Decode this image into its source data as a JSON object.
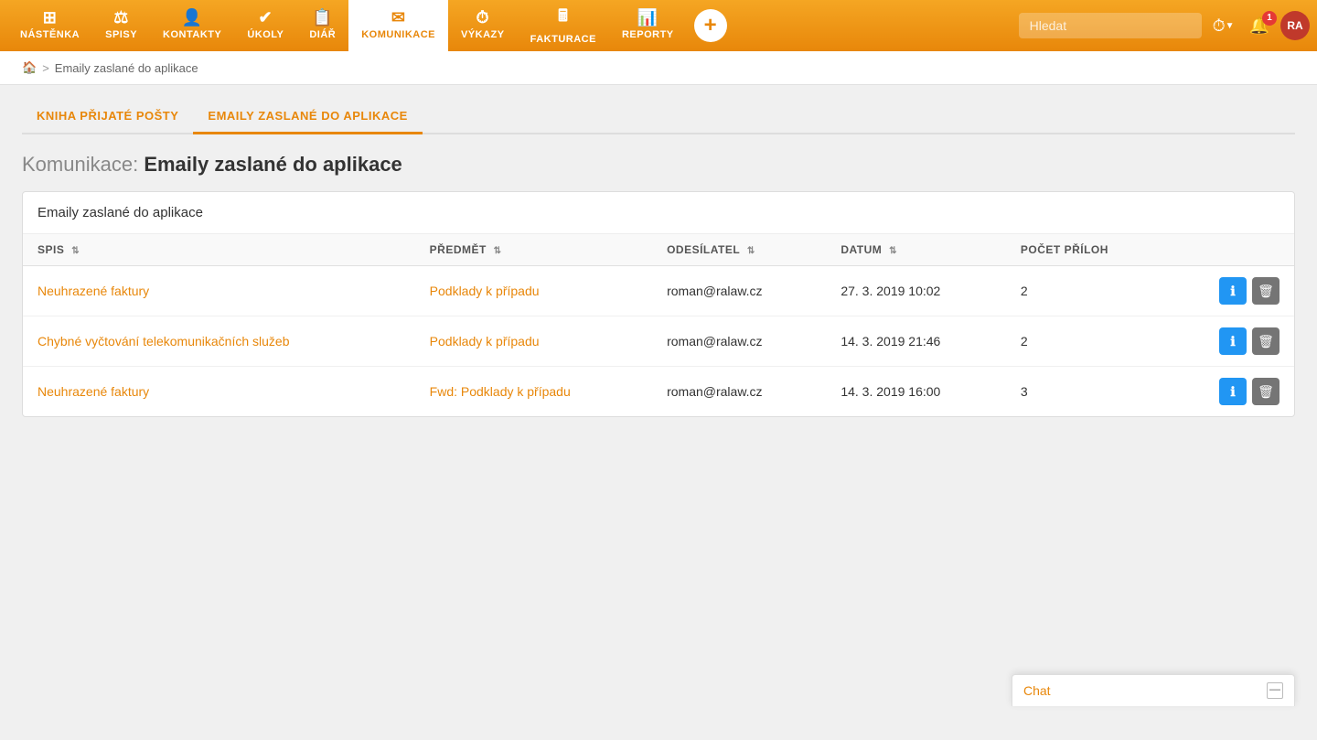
{
  "nav": {
    "items": [
      {
        "id": "nastenkа",
        "label": "NÁSTĚNKA",
        "icon": "⊞",
        "active": false
      },
      {
        "id": "spisy",
        "label": "SPISY",
        "icon": "⚖",
        "active": false
      },
      {
        "id": "kontakty",
        "label": "KONTAKTY",
        "icon": "👤",
        "active": false
      },
      {
        "id": "ukoly",
        "label": "ÚKOLY",
        "icon": "✔",
        "active": false
      },
      {
        "id": "diar",
        "label": "DIÁŘ",
        "icon": "📋",
        "active": false
      },
      {
        "id": "komunikace",
        "label": "KOMUNIKACE",
        "icon": "✉",
        "active": true
      },
      {
        "id": "vykazy",
        "label": "VÝKAZY",
        "icon": "⏱",
        "active": false
      },
      {
        "id": "fakturace",
        "label": "FAKTURACE",
        "icon": "🖩",
        "active": false
      },
      {
        "id": "reporty",
        "label": "REPORTY",
        "icon": "📊",
        "active": false
      }
    ],
    "add_button": "+",
    "search_placeholder": "Hledat",
    "notification_count": "1",
    "avatar_initials": "RA"
  },
  "breadcrumb": {
    "home_icon": "🏠",
    "separator": ">",
    "current": "Emaily zaslané do aplikace"
  },
  "tabs": [
    {
      "id": "kniha",
      "label": "KNIHA PŘIJATÉ POŠTY",
      "active": false
    },
    {
      "id": "emaily",
      "label": "EMAILY ZASLANÉ DO APLIKACE",
      "active": true
    }
  ],
  "page": {
    "title_label": "Komunikace:",
    "title_main": "Emaily zaslané do aplikace"
  },
  "table": {
    "card_title": "Emaily zaslané do aplikace",
    "columns": [
      {
        "id": "spis",
        "label": "SPIS",
        "sortable": true
      },
      {
        "id": "predmet",
        "label": "PŘEDMĚT",
        "sortable": true
      },
      {
        "id": "odesilatel",
        "label": "ODESÍLATEL",
        "sortable": true
      },
      {
        "id": "datum",
        "label": "DATUM",
        "sortable": true
      },
      {
        "id": "pocet_priloh",
        "label": "POČET PŘÍLOH",
        "sortable": false
      },
      {
        "id": "actions",
        "label": "",
        "sortable": false
      }
    ],
    "rows": [
      {
        "spis": "Neuhrazené faktury",
        "predmet": "Podklady k případu",
        "odesilatel": "roman@ralaw.cz",
        "datum": "27. 3. 2019 10:02",
        "pocet_priloh": "2"
      },
      {
        "spis": "Chybné vyčtování telekomunikačních služeb",
        "predmet": "Podklady k případu",
        "odesilatel": "roman@ralaw.cz",
        "datum": "14. 3. 2019 21:46",
        "pocet_priloh": "2"
      },
      {
        "spis": "Neuhrazené faktury",
        "predmet": "Fwd: Podklady k případu",
        "odesilatel": "roman@ralaw.cz",
        "datum": "14. 3. 2019 16:00",
        "pocet_priloh": "3"
      }
    ]
  },
  "chat": {
    "label": "Chat",
    "minimize_icon": "—"
  }
}
